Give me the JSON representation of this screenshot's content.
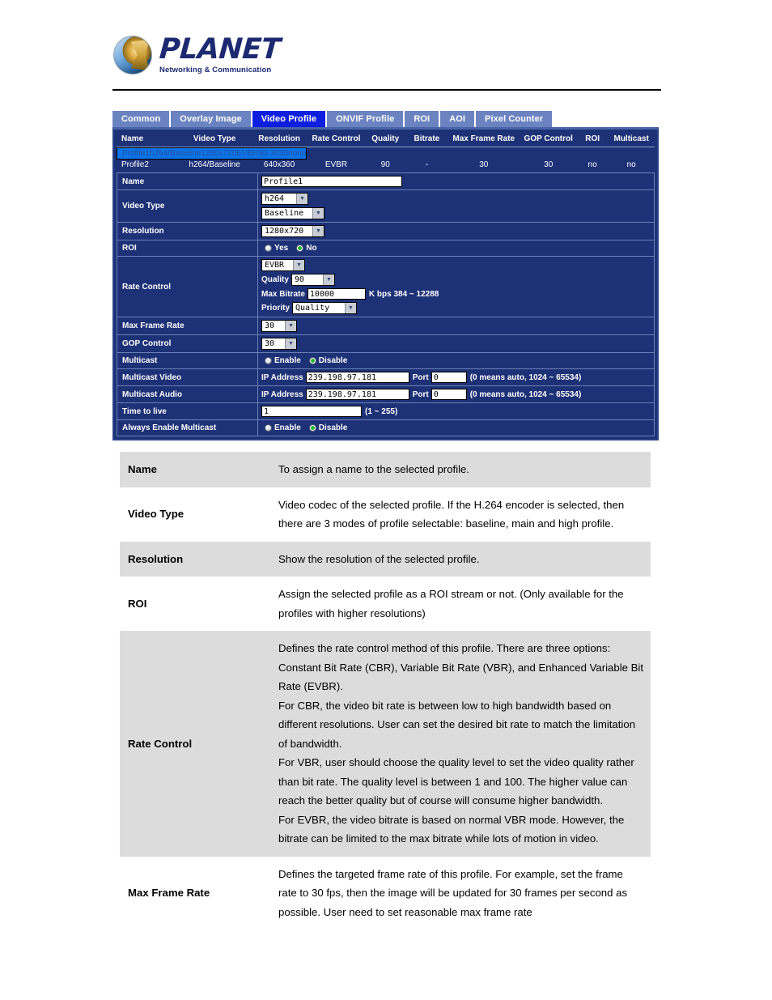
{
  "header": {
    "brand": "PLANET",
    "tagline": "Networking & Communication"
  },
  "tabs": [
    {
      "label": "Common",
      "active": false
    },
    {
      "label": "Overlay Image",
      "active": false
    },
    {
      "label": "Video Profile",
      "active": true
    },
    {
      "label": "ONVIF Profile",
      "active": false
    },
    {
      "label": "ROI",
      "active": false
    },
    {
      "label": "AOI",
      "active": false
    },
    {
      "label": "Pixel Counter",
      "active": false
    }
  ],
  "profile_table": {
    "columns": [
      "Name",
      "Video Type",
      "Resolution",
      "Rate Control",
      "Quality",
      "Bitrate",
      "Max Frame Rate",
      "GOP Control",
      "ROI",
      "Multicast"
    ],
    "rows": [
      {
        "selected": true,
        "name": "Profile1",
        "video_type": "h264/Baseline",
        "resolution": "1280x720",
        "rate_control": "EVBR",
        "quality": "90",
        "bitrate": "-",
        "max_frame_rate": "30",
        "gop_control": "30",
        "roi": "no",
        "multicast": "no"
      },
      {
        "selected": false,
        "name": "Profile2",
        "video_type": "h264/Baseline",
        "resolution": "640x360",
        "rate_control": "EVBR",
        "quality": "90",
        "bitrate": "-",
        "max_frame_rate": "30",
        "gop_control": "30",
        "roi": "no",
        "multicast": "no"
      }
    ]
  },
  "form": {
    "name": {
      "label": "Name",
      "value": "Profile1"
    },
    "video_type": {
      "label": "Video Type",
      "codec": "h264",
      "profile": "Baseline"
    },
    "resolution": {
      "label": "Resolution",
      "value": "1280x720"
    },
    "roi": {
      "label": "ROI",
      "yes_label": "Yes",
      "no_label": "No",
      "selected": "No"
    },
    "rate_control": {
      "label": "Rate Control",
      "mode": "EVBR",
      "quality_label": "Quality",
      "quality": "90",
      "max_bitrate_label": "Max Bitrate",
      "max_bitrate": "10000",
      "bitrate_hint": "K bps 384 ~ 12288",
      "priority_label": "Priority",
      "priority": "Quality"
    },
    "max_frame_rate": {
      "label": "Max Frame Rate",
      "value": "30"
    },
    "gop_control": {
      "label": "GOP Control",
      "value": "30"
    },
    "multicast": {
      "label": "Multicast",
      "enable_label": "Enable",
      "disable_label": "Disable",
      "selected": "Disable"
    },
    "multicast_video": {
      "label": "Multicast Video",
      "ip_label": "IP Address",
      "ip": "239.198.97.181",
      "port_label": "Port",
      "port": "0",
      "hint": "(0 means auto, 1024 ~ 65534)"
    },
    "multicast_audio": {
      "label": "Multicast Audio",
      "ip_label": "IP Address",
      "ip": "239.198.97.181",
      "port_label": "Port",
      "port": "0",
      "hint": "(0 means auto, 1024 ~ 65534)"
    },
    "time_to_live": {
      "label": "Time to live",
      "value": "1",
      "hint": "(1 ~ 255)"
    },
    "always_enable_multicast": {
      "label": "Always Enable Multicast",
      "enable_label": "Enable",
      "disable_label": "Disable",
      "selected": "Disable"
    }
  },
  "descriptions": [
    {
      "key": "Name",
      "lines": [
        "To assign a name to the selected profile."
      ]
    },
    {
      "key": "Video Type",
      "lines": [
        "Video codec of the selected profile. If the H.264 encoder is selected, then there are 3 modes of profile selectable: baseline, main and high profile."
      ]
    },
    {
      "key": "Resolution",
      "lines": [
        "Show the resolution of the selected profile."
      ]
    },
    {
      "key": "ROI",
      "lines": [
        "Assign the selected profile as a ROI stream or not. (Only available for the profiles with higher resolutions)"
      ]
    },
    {
      "key": "Rate Control",
      "lines": [
        "Defines the rate control method of this profile. There are three options: Constant Bit Rate (CBR), Variable Bit Rate (VBR), and Enhanced Variable Bit Rate (EVBR).",
        "For CBR, the video bit rate is between low to high bandwidth based on different resolutions. User can set the desired bit rate to match the limitation of bandwidth.",
        "For VBR, user should choose the quality level to set the video quality rather than bit rate. The quality level is between 1 and 100. The higher value can reach the better quality but of course will consume higher bandwidth.",
        "For EVBR, the video bitrate is based on normal VBR mode. However, the bitrate can be limited to the max bitrate while lots of motion in video."
      ]
    },
    {
      "key": "Max Frame Rate",
      "lines": [
        "Defines the targeted frame rate of this profile. For example, set the frame rate to 30 fps, then the image will be updated for 30 frames per second as possible. User need to set reasonable max frame rate"
      ]
    }
  ]
}
